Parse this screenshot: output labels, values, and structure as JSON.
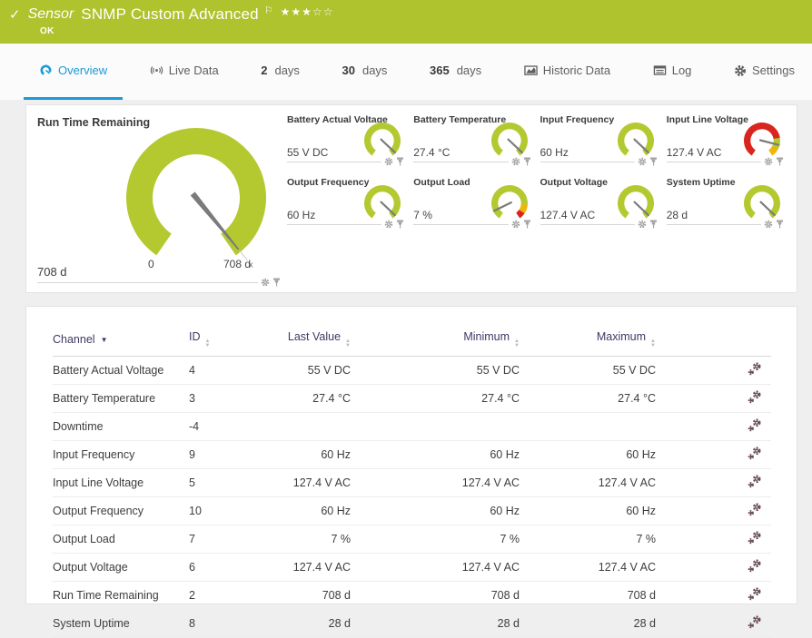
{
  "colors": {
    "ok_green": "#aec32d",
    "accent_blue": "#1c9ad6",
    "gauge_green": "#b4c930",
    "gauge_red": "#d9251d",
    "gauge_yellow": "#eeb50a",
    "needle_gray": "#7b7b7b"
  },
  "header": {
    "status_icon": "✓",
    "kind_label": "Sensor",
    "title": "SNMP Custom Advanced",
    "flag_icon": "⚐",
    "rating": {
      "filled": 3,
      "total": 5
    },
    "status": "OK"
  },
  "tabs": [
    {
      "label": "Overview",
      "icon": "gauge",
      "active": true
    },
    {
      "label": "Live Data",
      "icon": "broadcast",
      "active": false
    },
    {
      "prefix": "2",
      "label": "days",
      "active": false
    },
    {
      "prefix": "30",
      "label": "days",
      "active": false
    },
    {
      "prefix": "365",
      "label": "days",
      "active": false
    },
    {
      "label": "Historic Data",
      "icon": "chart",
      "active": false
    },
    {
      "label": "Log",
      "icon": "log",
      "active": false
    },
    {
      "label": "Settings",
      "icon": "gear",
      "active": false
    }
  ],
  "gauges": {
    "primary": {
      "title": "Run Time Remaining",
      "value": "708 d",
      "scale_min": "0",
      "scale_max": "708 d",
      "tip_marker": "x",
      "segments": [
        {
          "color": "#b4c930",
          "frac": 1
        }
      ],
      "needle": 0.985
    },
    "tiles": [
      {
        "title": "Battery Actual Voltage",
        "value": "55 V DC",
        "segments": [
          {
            "color": "#b4c930",
            "frac": 1
          }
        ],
        "needle": 0.96
      },
      {
        "title": "Battery Temperature",
        "value": "27.4 °C",
        "segments": [
          {
            "color": "#b4c930",
            "frac": 1
          }
        ],
        "needle": 0.96
      },
      {
        "title": "Input Frequency",
        "value": "60 Hz",
        "segments": [
          {
            "color": "#b4c930",
            "frac": 1
          }
        ],
        "needle": 0.96
      },
      {
        "title": "Input Line Voltage",
        "value": "127.4 V AC",
        "segments": [
          {
            "color": "#d9251d",
            "frac": 0.78
          },
          {
            "color": "#b4c930",
            "frac": 0.125
          },
          {
            "color": "#eeb50a",
            "frac": 0.095
          }
        ],
        "needle": 0.86
      },
      {
        "title": "Output Frequency",
        "value": "60 Hz",
        "segments": [
          {
            "color": "#b4c930",
            "frac": 1
          }
        ],
        "needle": 0.96
      },
      {
        "title": "Output Load",
        "value": "7 %",
        "segments": [
          {
            "color": "#b4c930",
            "frac": 0.825
          },
          {
            "color": "#eeb50a",
            "frac": 0.105
          },
          {
            "color": "#d9251d",
            "frac": 0.07
          }
        ],
        "needle": 0.1
      },
      {
        "title": "Output Voltage",
        "value": "127.4 V AC",
        "segments": [
          {
            "color": "#b4c930",
            "frac": 1
          }
        ],
        "needle": 0.96
      },
      {
        "title": "System Uptime",
        "value": "28 d",
        "segments": [
          {
            "color": "#b4c930",
            "frac": 1
          }
        ],
        "needle": 0.96
      }
    ]
  },
  "table": {
    "columns": [
      {
        "label": "Channel",
        "sort": "active-desc",
        "align": "left"
      },
      {
        "label": "ID",
        "sort": "sortable",
        "align": "left"
      },
      {
        "label": "Last Value",
        "sort": "sortable",
        "align": "right"
      },
      {
        "label": "Minimum",
        "sort": "sortable",
        "align": "right"
      },
      {
        "label": "Maximum",
        "sort": "sortable",
        "align": "right"
      },
      {
        "label": "",
        "sort": "none",
        "align": "right"
      }
    ],
    "rows": [
      {
        "cells": [
          "Battery Actual Voltage",
          "4",
          "55 V DC",
          "55 V DC",
          "55 V DC"
        ]
      },
      {
        "cells": [
          "Battery Temperature",
          "3",
          "27.4 °C",
          "27.4 °C",
          "27.4 °C"
        ]
      },
      {
        "cells": [
          "Downtime",
          "-4",
          "",
          "",
          ""
        ]
      },
      {
        "cells": [
          "Input Frequency",
          "9",
          "60 Hz",
          "60 Hz",
          "60 Hz"
        ]
      },
      {
        "cells": [
          "Input Line Voltage",
          "5",
          "127.4 V AC",
          "127.4 V AC",
          "127.4 V AC"
        ]
      },
      {
        "cells": [
          "Output Frequency",
          "10",
          "60 Hz",
          "60 Hz",
          "60 Hz"
        ]
      },
      {
        "cells": [
          "Output Load",
          "7",
          "7 %",
          "7 %",
          "7 %"
        ]
      },
      {
        "cells": [
          "Output Voltage",
          "6",
          "127.4 V AC",
          "127.4 V AC",
          "127.4 V AC"
        ]
      },
      {
        "cells": [
          "Run Time Remaining",
          "2",
          "708 d",
          "708 d",
          "708 d"
        ]
      },
      {
        "cells": [
          "System Uptime",
          "8",
          "28 d",
          "28 d",
          "28 d"
        ]
      }
    ]
  }
}
